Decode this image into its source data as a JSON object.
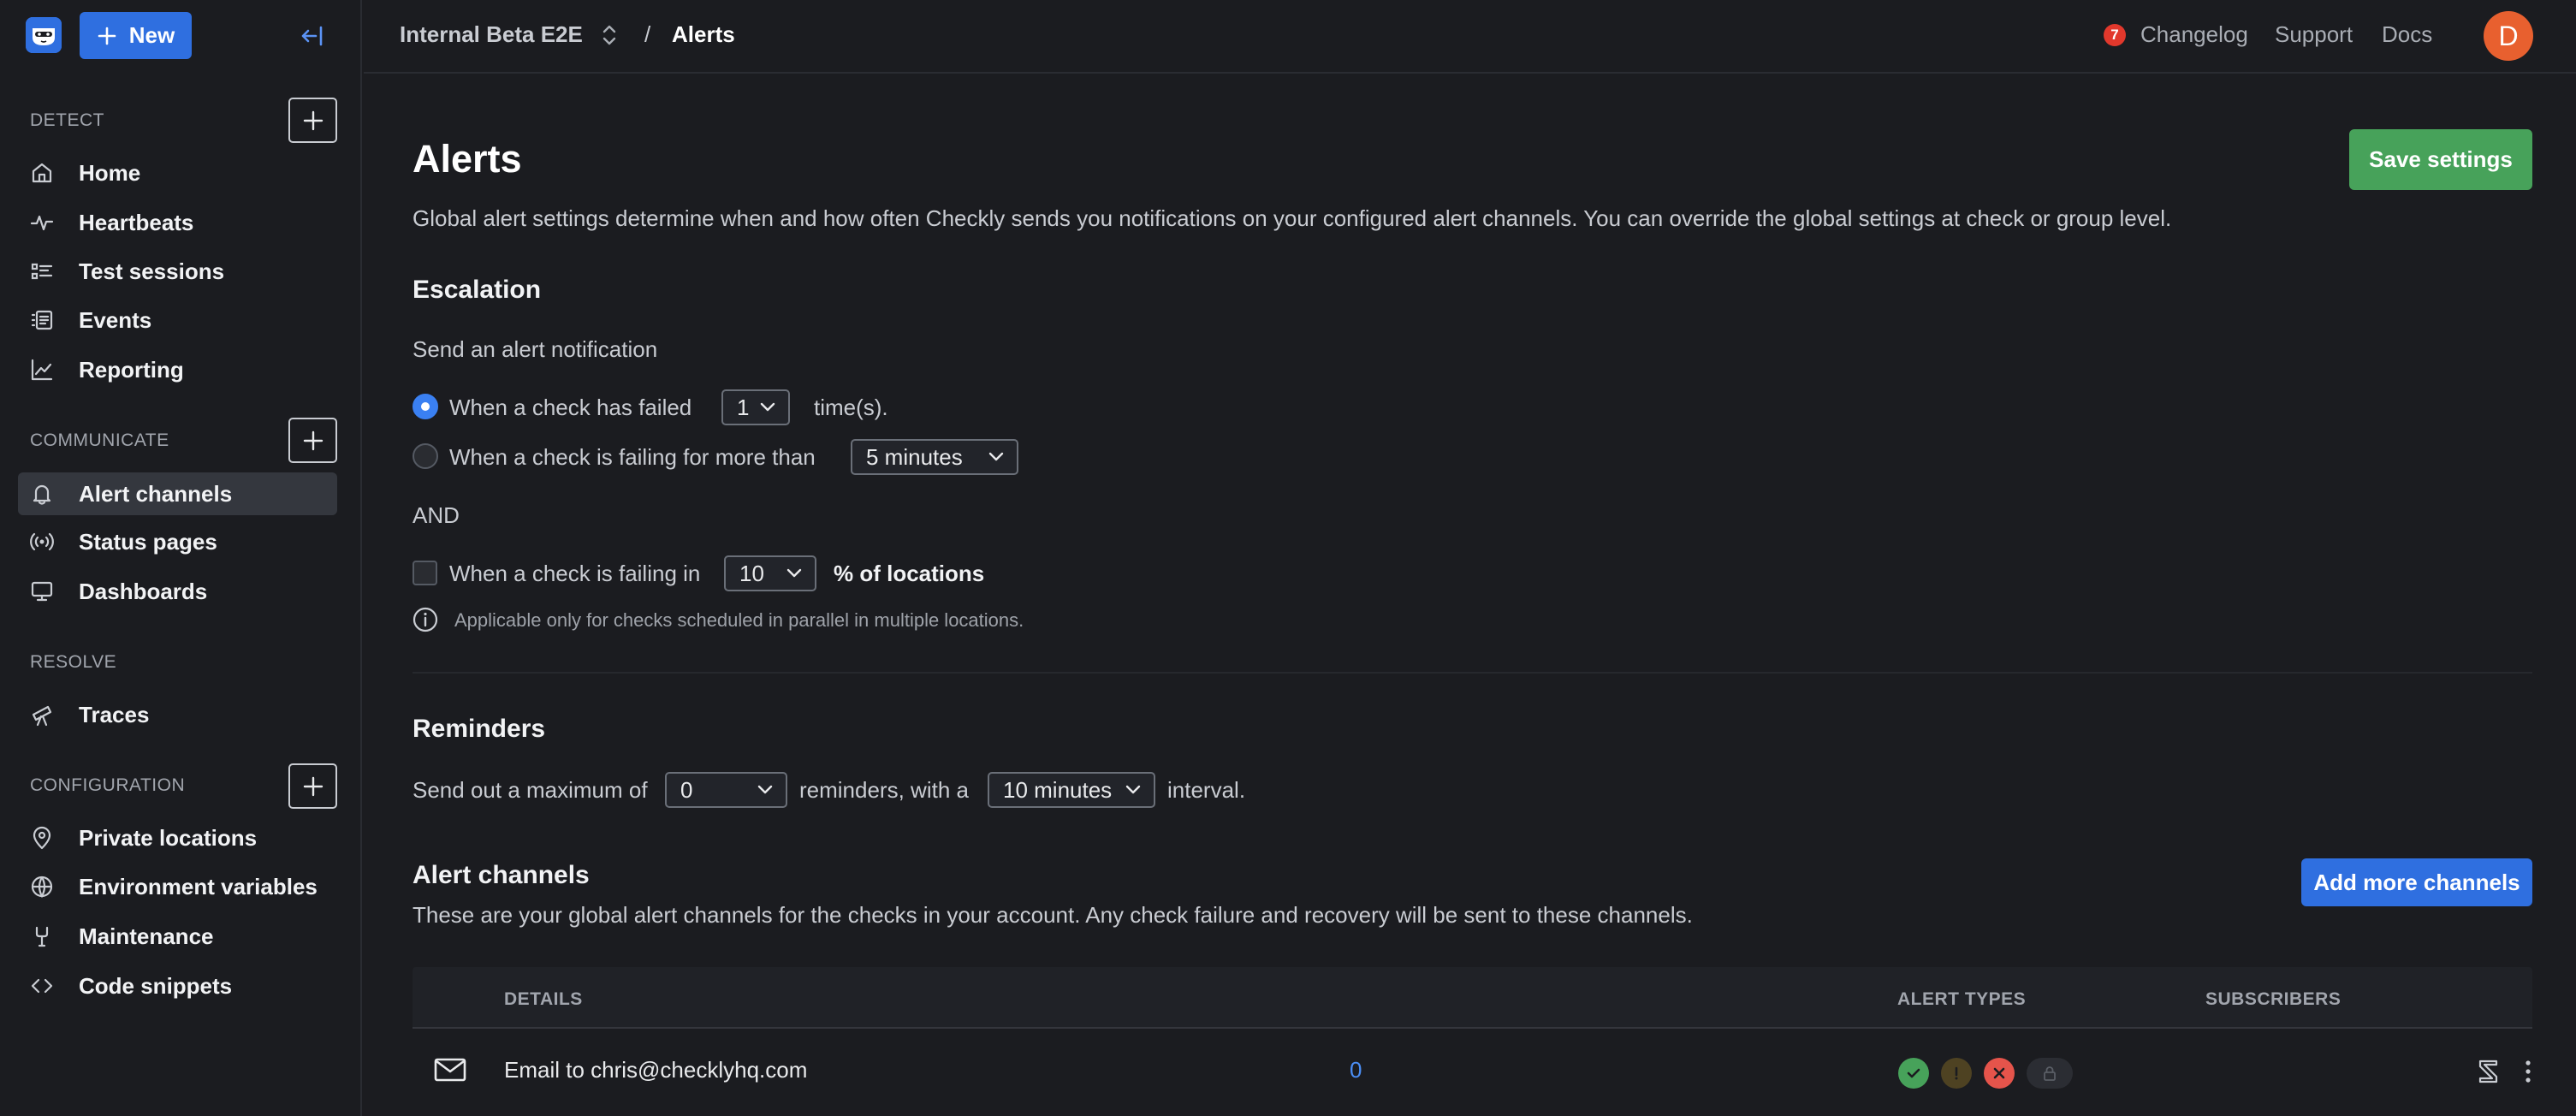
{
  "sidebar": {
    "new_label": "New",
    "sections": {
      "detect": "DETECT",
      "communicate": "COMMUNICATE",
      "resolve": "RESOLVE",
      "configuration": "CONFIGURATION"
    },
    "items": {
      "home": "Home",
      "heartbeats": "Heartbeats",
      "test_sessions": "Test sessions",
      "events": "Events",
      "reporting": "Reporting",
      "alert_channels": "Alert channels",
      "status_pages": "Status pages",
      "dashboards": "Dashboards",
      "traces": "Traces",
      "private_locations": "Private locations",
      "environment_variables": "Environment variables",
      "maintenance": "Maintenance",
      "code_snippets": "Code snippets"
    },
    "active_item": "alert_channels"
  },
  "topbar": {
    "project": "Internal Beta E2E",
    "separator": "/",
    "current": "Alerts",
    "changelog_count": "7",
    "changelog": "Changelog",
    "support": "Support",
    "docs": "Docs",
    "avatar_initial": "D"
  },
  "page": {
    "title": "Alerts",
    "save_label": "Save settings",
    "description": "Global alert settings determine when and how often Checkly sends you notifications on your configured alert channels. You can override the global settings at check or group level."
  },
  "escalation": {
    "title": "Escalation",
    "intro": "Send an alert notification",
    "option1_label": "When a check has failed",
    "option1_value": "1",
    "option1_suffix": "time(s).",
    "option2_label": "When a check is failing for more than",
    "option2_value": "5 minutes",
    "selected_option": 1,
    "and_label": "AND",
    "locations_label": "When a check is failing in",
    "locations_value": "10",
    "locations_suffix": "% of locations",
    "locations_checked": false,
    "hint": "Applicable only for checks scheduled in parallel in multiple locations."
  },
  "reminders": {
    "title": "Reminders",
    "prefix": "Send out a maximum of",
    "count_value": "0",
    "middle": "reminders, with a",
    "interval_value": "10 minutes",
    "suffix": "interval."
  },
  "alert_channels": {
    "title": "Alert channels",
    "description": "These are your global alert channels for the checks in your account. Any check failure and recovery will be sent to these channels.",
    "add_label": "Add more channels",
    "columns": {
      "details": "DETAILS",
      "alert_types": "ALERT TYPES",
      "subscribers": "SUBSCRIBERS"
    },
    "rows": [
      {
        "detail": "Email to chris@checklyhq.com",
        "subscribers": "0",
        "alert_types": [
          "recovered",
          "degraded",
          "failed",
          "ssl-locked"
        ]
      }
    ]
  },
  "colors": {
    "primary": "#2f6fe0",
    "success": "#47a25a",
    "danger": "#e5544b",
    "warning": "#5a4a1e",
    "avatar": "#e8602f"
  }
}
